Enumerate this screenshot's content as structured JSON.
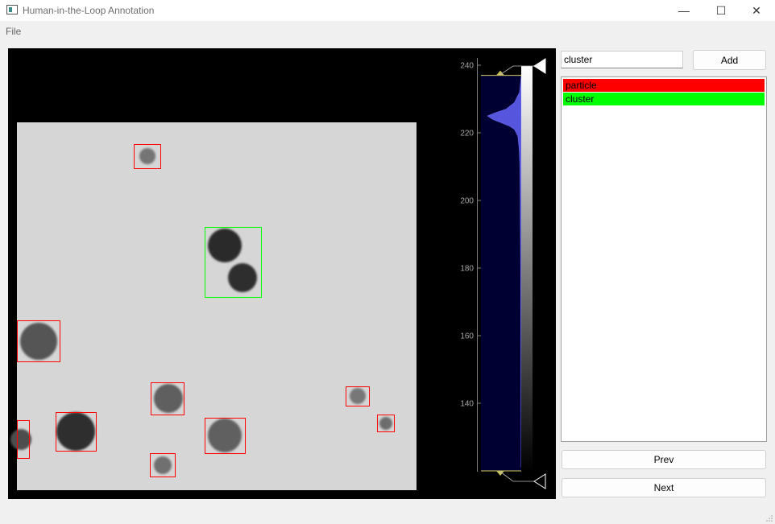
{
  "window": {
    "title": "Human-in-the-Loop Annotation",
    "minimize_glyph": "—",
    "maximize_glyph": "☐",
    "close_glyph": "✕"
  },
  "menu": {
    "file_label": "File"
  },
  "histogram": {
    "ticks": [
      {
        "value": 240,
        "label": "240"
      },
      {
        "value": 220,
        "label": "220"
      },
      {
        "value": 200,
        "label": "200"
      },
      {
        "value": 180,
        "label": "180"
      },
      {
        "value": 160,
        "label": "160"
      },
      {
        "value": 140,
        "label": "140"
      }
    ],
    "level_max": 237,
    "level_min": 120,
    "curve": [
      [
        237,
        0.0
      ],
      [
        232,
        0.05
      ],
      [
        229,
        0.2
      ],
      [
        227,
        0.45
      ],
      [
        226,
        0.75
      ],
      [
        225,
        1.0
      ],
      [
        224,
        0.85
      ],
      [
        223,
        0.6
      ],
      [
        222,
        0.35
      ],
      [
        221,
        0.2
      ],
      [
        219,
        0.1
      ],
      [
        215,
        0.06
      ],
      [
        210,
        0.04
      ],
      [
        200,
        0.03
      ],
      [
        180,
        0.02
      ],
      [
        160,
        0.015
      ],
      [
        140,
        0.01
      ],
      [
        121,
        0.0
      ]
    ],
    "fill_color": "#5555dd",
    "background_color": "#000033"
  },
  "annotation": {
    "label_input_value": "cluster",
    "add_label": "Add",
    "labels": [
      {
        "name": "particle",
        "color": "#ff0000"
      },
      {
        "name": "cluster",
        "color": "#00ff00"
      }
    ],
    "prev_label": "Prev",
    "next_label": "Next"
  }
}
